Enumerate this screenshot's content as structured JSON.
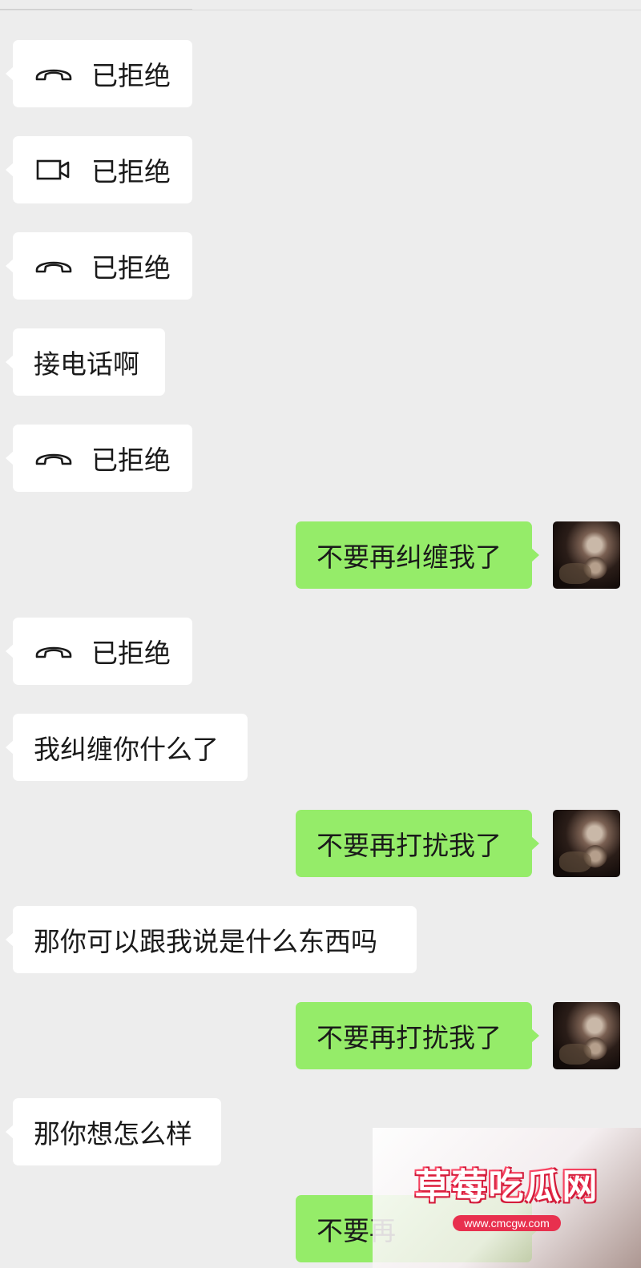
{
  "messages": [
    {
      "side": "left",
      "type": "voice_call",
      "icon": "phone-hangup-icon",
      "text": "已拒绝"
    },
    {
      "side": "left",
      "type": "video_call",
      "icon": "video-camera-icon",
      "text": "已拒绝"
    },
    {
      "side": "left",
      "type": "voice_call",
      "icon": "phone-hangup-icon",
      "text": "已拒绝"
    },
    {
      "side": "left",
      "type": "text",
      "text": "接电话啊"
    },
    {
      "side": "left",
      "type": "voice_call",
      "icon": "phone-hangup-icon",
      "text": "已拒绝"
    },
    {
      "side": "right",
      "type": "text",
      "text": "不要再纠缠我了"
    },
    {
      "side": "left",
      "type": "voice_call",
      "icon": "phone-hangup-icon",
      "text": "已拒绝"
    },
    {
      "side": "left",
      "type": "text",
      "text": "我纠缠你什么了"
    },
    {
      "side": "right",
      "type": "text",
      "text": "不要再打扰我了"
    },
    {
      "side": "left",
      "type": "text",
      "text": "那你可以跟我说是什么东西吗"
    },
    {
      "side": "right",
      "type": "text",
      "text": "不要再打扰我了"
    },
    {
      "side": "left",
      "type": "text",
      "text": "那你想怎么样"
    },
    {
      "side": "right",
      "type": "text",
      "text": "不要再"
    }
  ],
  "watermark": {
    "title": "草莓吃瓜网",
    "url": "www.cmcgw.com"
  },
  "colors": {
    "background": "#ededed",
    "incoming_bubble": "#ffffff",
    "outgoing_bubble": "#95ec69",
    "watermark_accent": "#e8304e"
  }
}
